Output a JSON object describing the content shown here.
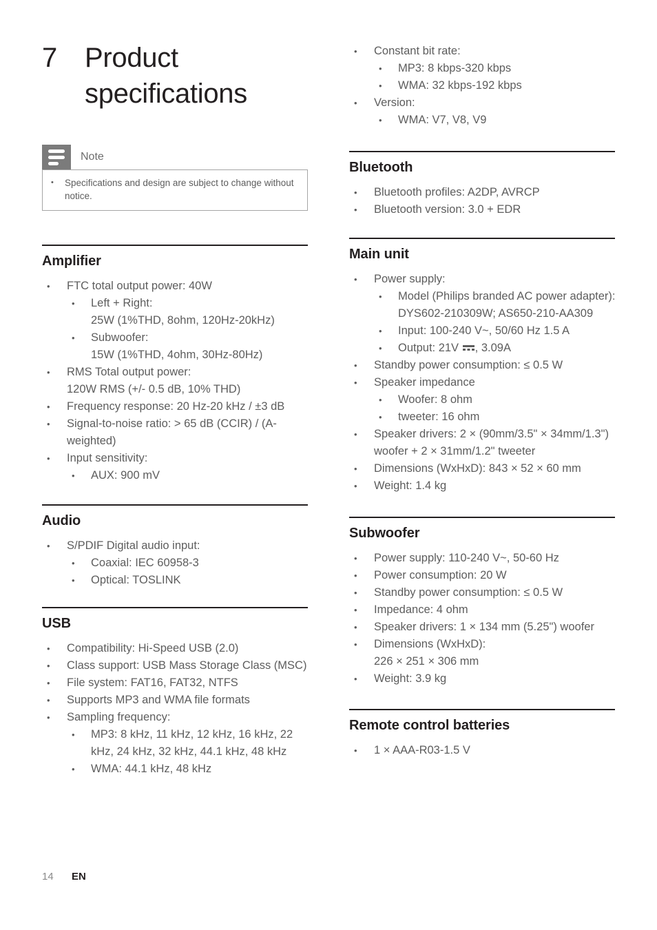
{
  "chapter": {
    "number": "7",
    "title": "Product specifications"
  },
  "note": {
    "label": "Note",
    "icon": "note-lines-icon",
    "items": [
      "Specifications and design are subject to change without notice."
    ]
  },
  "footer": {
    "page_number": "14",
    "language": "EN"
  },
  "left_column": {
    "sections": [
      {
        "heading": "Amplifier",
        "items": [
          {
            "text": "FTC total output power: 40W",
            "children": [
              {
                "text": "Left + Right:",
                "extra": "25W (1%THD, 8ohm, 120Hz-20kHz)"
              },
              {
                "text": "Subwoofer:",
                "extra": "15W (1%THD, 4ohm, 30Hz-80Hz)"
              }
            ]
          },
          {
            "text": "RMS Total output power:",
            "extra": "120W RMS (+/- 0.5 dB, 10% THD)"
          },
          {
            "text": "Frequency response: 20 Hz-20 kHz / ±3 dB"
          },
          {
            "text": "Signal-to-noise ratio: > 65 dB (CCIR) / (A-weighted)"
          },
          {
            "text": "Input sensitivity:",
            "children": [
              {
                "text": "AUX: 900 mV"
              }
            ]
          }
        ]
      },
      {
        "heading": "Audio",
        "items": [
          {
            "text": "S/PDIF Digital audio input:",
            "children": [
              {
                "text": "Coaxial: IEC 60958-3"
              },
              {
                "text": "Optical: TOSLINK"
              }
            ]
          }
        ]
      },
      {
        "heading": "USB",
        "items": [
          {
            "text": "Compatibility: Hi-Speed USB (2.0)"
          },
          {
            "text": "Class support: USB Mass Storage Class (MSC)"
          },
          {
            "text": "File system: FAT16, FAT32, NTFS"
          },
          {
            "text": "Supports MP3 and WMA file formats"
          },
          {
            "text": "Sampling frequency:",
            "children": [
              {
                "text": "MP3: 8 kHz, 11 kHz, 12 kHz, 16 kHz, 22 kHz, 24 kHz, 32 kHz, 44.1 kHz, 48 kHz"
              },
              {
                "text": "WMA: 44.1 kHz, 48 kHz"
              }
            ]
          }
        ]
      }
    ]
  },
  "right_column": {
    "continued_items": [
      {
        "text": "Constant bit rate:",
        "children": [
          {
            "text": "MP3: 8 kbps-320 kbps"
          },
          {
            "text": "WMA: 32 kbps-192 kbps"
          }
        ]
      },
      {
        "text": "Version:",
        "children": [
          {
            "text": "WMA: V7, V8, V9"
          }
        ]
      }
    ],
    "sections": [
      {
        "heading": "Bluetooth",
        "items": [
          {
            "text": "Bluetooth profiles: A2DP, AVRCP"
          },
          {
            "text": "Bluetooth version: 3.0 + EDR"
          }
        ]
      },
      {
        "heading": "Main unit",
        "items": [
          {
            "text": "Power supply:",
            "children": [
              {
                "text": "Model (Philips branded AC power adapter): DYS602-210309W; AS650-210-AA309"
              },
              {
                "text": "Input: 100-240 V~, 50/60 Hz 1.5 A"
              },
              {
                "text": "Output: 21V",
                "dc_symbol": true,
                "text_after": ", 3.09A"
              }
            ]
          },
          {
            "text": "Standby power consumption: ≤ 0.5 W"
          },
          {
            "text": "Speaker impedance",
            "children": [
              {
                "text": "Woofer: 8 ohm"
              },
              {
                "text": "tweeter: 16 ohm"
              }
            ]
          },
          {
            "text": "Speaker drivers: 2 × (90mm/3.5\" × 34mm/1.3\") woofer + 2 × 31mm/1.2\" tweeter"
          },
          {
            "text": "Dimensions (WxHxD): 843 × 52 × 60 mm"
          },
          {
            "text": "Weight: 1.4 kg"
          }
        ]
      },
      {
        "heading": "Subwoofer",
        "items": [
          {
            "text": "Power supply: 110-240 V~, 50-60 Hz"
          },
          {
            "text": "Power consumption: 20 W"
          },
          {
            "text": "Standby power consumption: ≤ 0.5 W"
          },
          {
            "text": "Impedance: 4 ohm"
          },
          {
            "text": "Speaker drivers: 1 × 134 mm (5.25\") woofer"
          },
          {
            "text": "Dimensions (WxHxD):",
            "extra": "226 × 251 × 306 mm"
          },
          {
            "text": "Weight: 3.9 kg"
          }
        ]
      },
      {
        "heading": "Remote control batteries",
        "items": [
          {
            "text": "1 × AAA-R03-1.5 V"
          }
        ]
      }
    ]
  },
  "bullet_glyph": "•"
}
